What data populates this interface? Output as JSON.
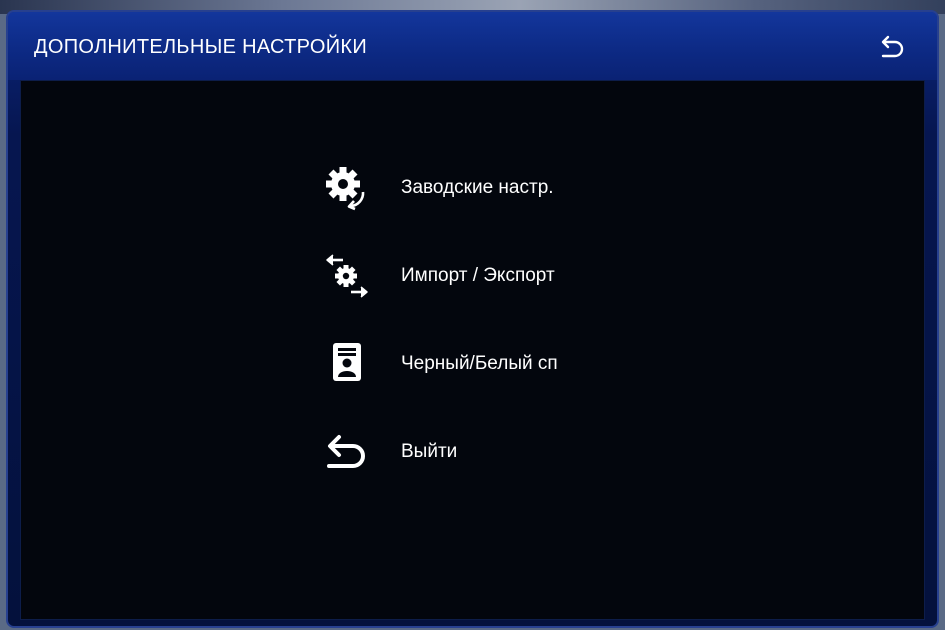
{
  "header": {
    "title": "ДОПОЛНИТЕЛЬНЫЕ НАСТРОЙКИ"
  },
  "menu": {
    "items": [
      {
        "label": "Заводские настр.",
        "icon": "gear-reset-icon"
      },
      {
        "label": "Импорт / Экспорт",
        "icon": "gear-transfer-icon"
      },
      {
        "label": "Черный/Белый сп",
        "icon": "id-card-icon"
      },
      {
        "label": "Выйти",
        "icon": "return-arrow-icon"
      }
    ]
  },
  "colors": {
    "title_bar": "#0d2a85",
    "panel_bg": "#03060d",
    "text": "#ffffff"
  }
}
